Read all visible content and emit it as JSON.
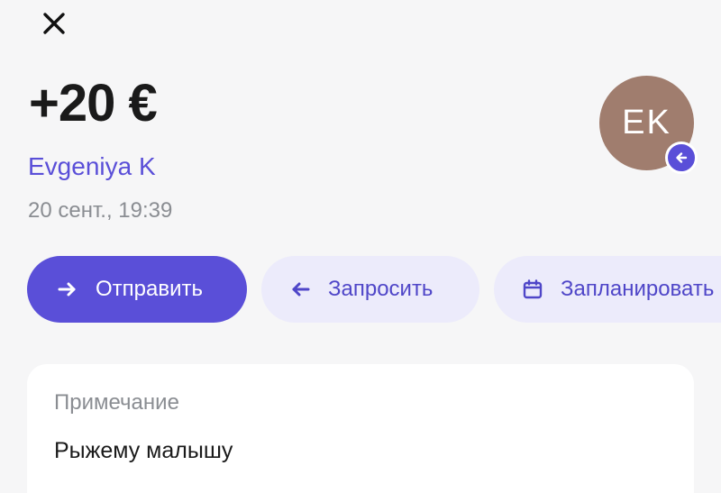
{
  "header": {
    "close_icon": "close-icon"
  },
  "transaction": {
    "amount": "+20 €",
    "counterparty": "Evgeniya K",
    "datetime": "20 сент., 19:39",
    "avatar_initials": "EK",
    "avatar_color": "#a07d6e",
    "direction_icon": "arrow-left-icon"
  },
  "actions": {
    "send_label": "Отправить",
    "request_label": "Запросить",
    "schedule_label": "Запланировать"
  },
  "note": {
    "label": "Примечание",
    "text": "Рыжему малышу"
  },
  "colors": {
    "accent": "#5a4fd8",
    "accent_soft": "#ecebfb",
    "background": "#f6f6f7",
    "muted_text": "#8a8d92"
  }
}
